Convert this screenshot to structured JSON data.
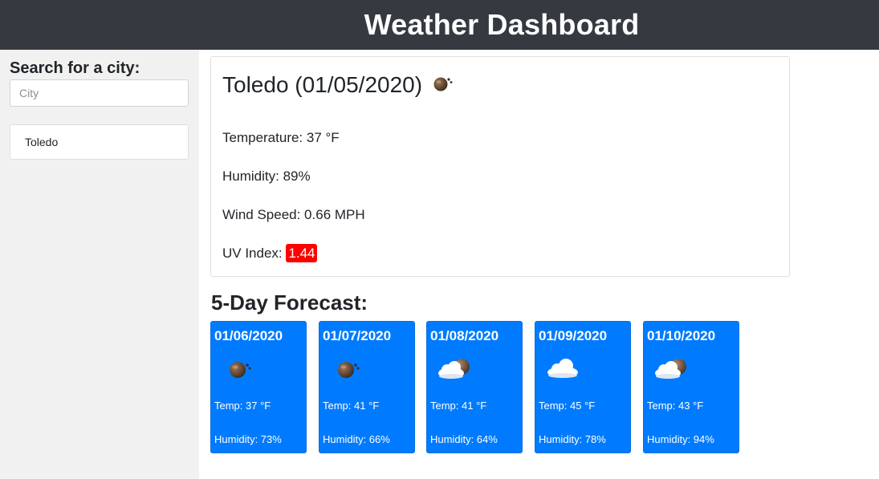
{
  "header": {
    "title": "Weather Dashboard"
  },
  "sidebar": {
    "search_label": "Search for a city:",
    "search_placeholder": "City",
    "search_value": "",
    "history": [
      {
        "label": "Toledo"
      }
    ]
  },
  "current": {
    "title": "Toledo (01/05/2020)",
    "icon": "rain-icon",
    "temperature": "Temperature: 37 °F",
    "humidity": "Humidity: 89%",
    "wind": "Wind Speed: 0.66 MPH",
    "uv_label": "UV Index:",
    "uv_value": "1.44",
    "uv_color": "#ff0000"
  },
  "forecast": {
    "title": "5-Day Forecast:",
    "accent": "#007bff",
    "days": [
      {
        "date": "01/06/2020",
        "icon": "rain-icon",
        "temp": "Temp: 37 °F",
        "humidity": "Humidity: 73%"
      },
      {
        "date": "01/07/2020",
        "icon": "rain-icon",
        "temp": "Temp: 41 °F",
        "humidity": "Humidity: 66%"
      },
      {
        "date": "01/08/2020",
        "icon": "cloud-moon-icon",
        "temp": "Temp: 41 °F",
        "humidity": "Humidity: 64%"
      },
      {
        "date": "01/09/2020",
        "icon": "cloud-icon",
        "temp": "Temp: 45 °F",
        "humidity": "Humidity: 78%"
      },
      {
        "date": "01/10/2020",
        "icon": "cloud-moon-icon",
        "temp": "Temp: 43 °F",
        "humidity": "Humidity: 94%"
      }
    ]
  }
}
